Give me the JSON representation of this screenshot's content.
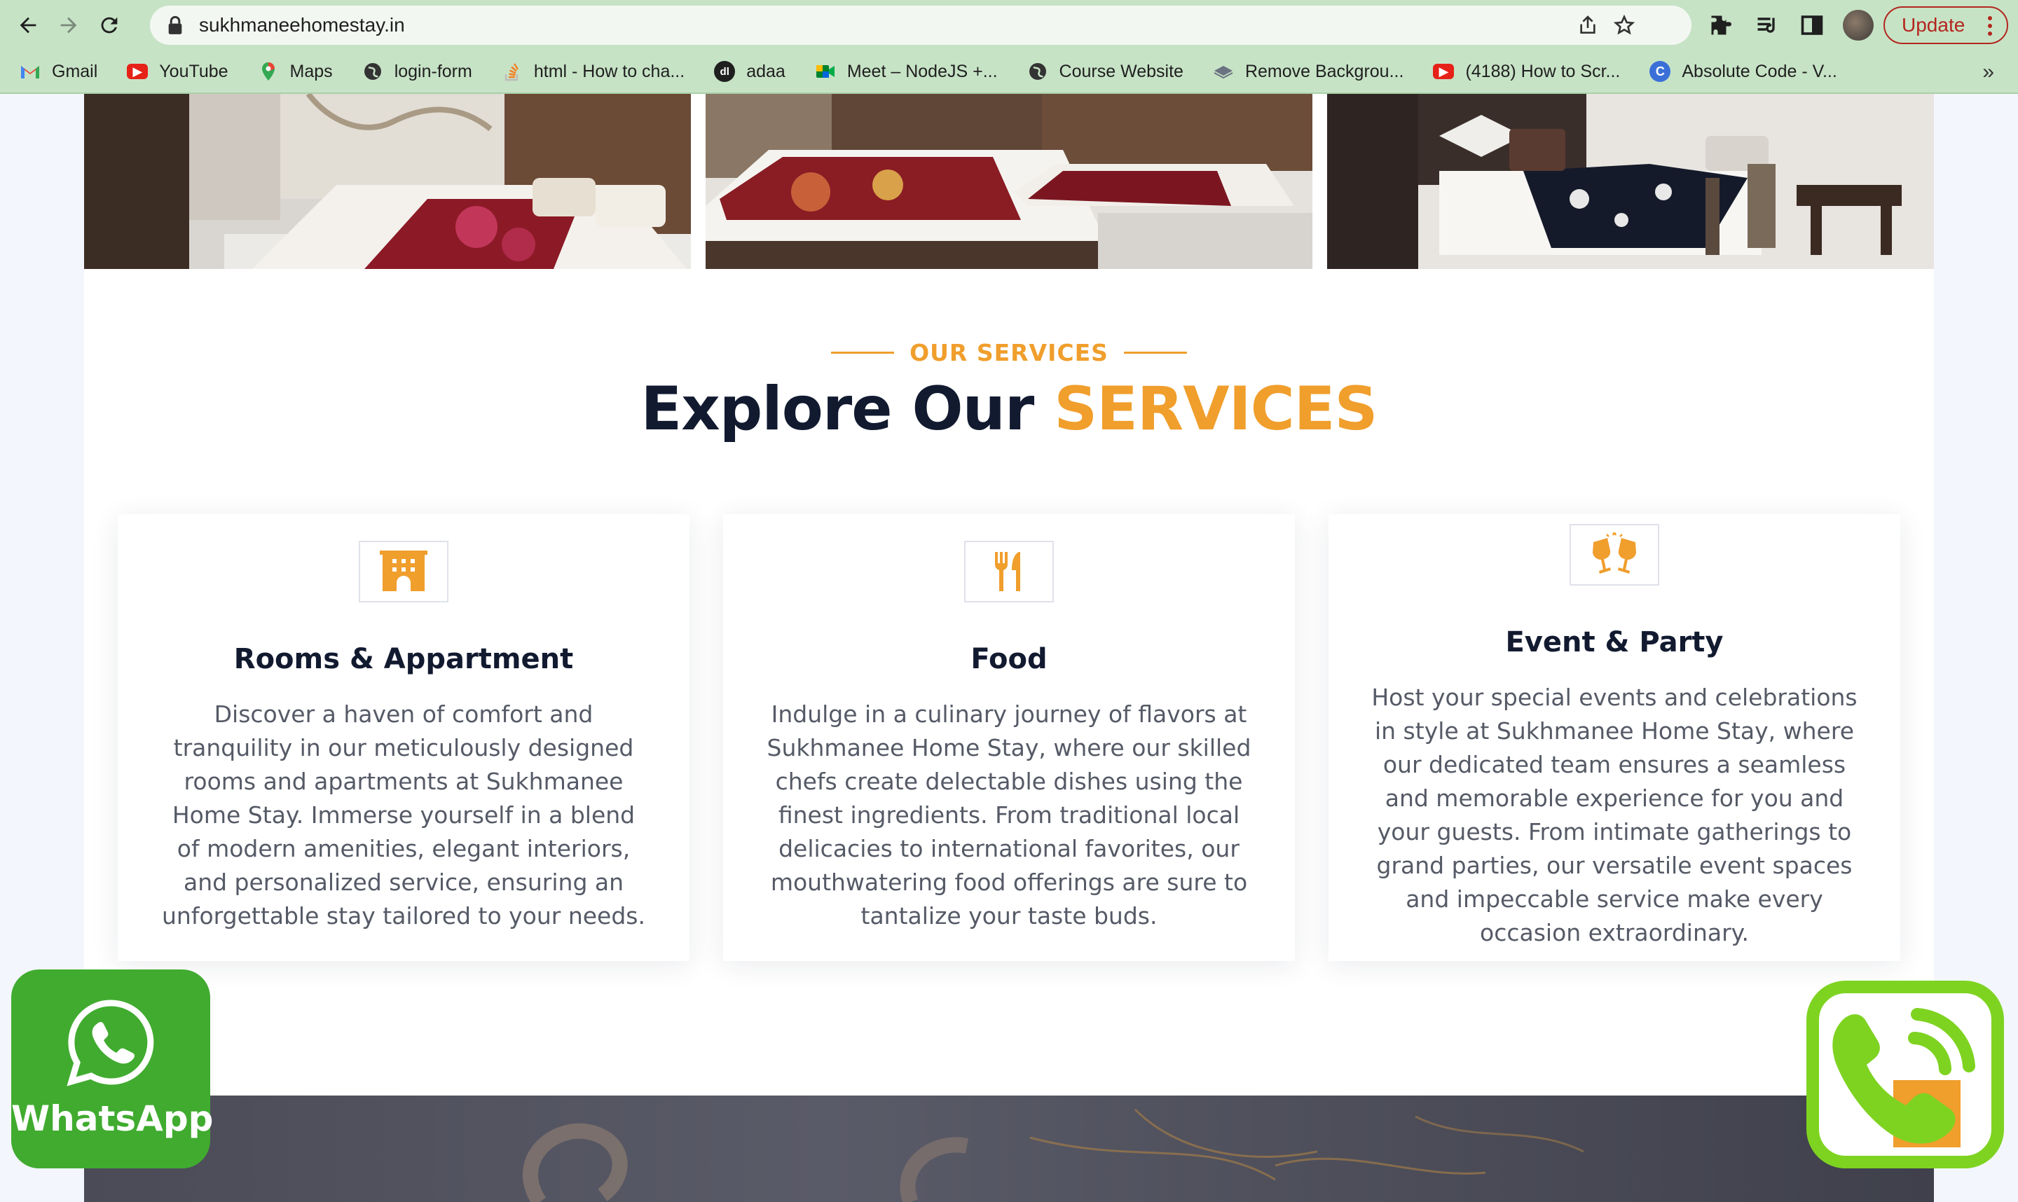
{
  "browser": {
    "url": "sukhmaneehomestay.in",
    "update_label": "Update",
    "bookmarks": [
      {
        "label": "Gmail",
        "icon": "gmail-icon"
      },
      {
        "label": "YouTube",
        "icon": "youtube-icon"
      },
      {
        "label": "Maps",
        "icon": "maps-icon"
      },
      {
        "label": "login-form",
        "icon": "globe-icon"
      },
      {
        "label": "html - How to cha...",
        "icon": "stackoverflow-icon"
      },
      {
        "label": "adaa",
        "icon": "adaa-icon"
      },
      {
        "label": "Meet – NodeJS +...",
        "icon": "meet-icon"
      },
      {
        "label": "Course Website",
        "icon": "globe-icon"
      },
      {
        "label": "Remove Backgrou...",
        "icon": "layers-icon"
      },
      {
        "label": "(4188) How to Scr...",
        "icon": "youtube-icon"
      },
      {
        "label": "Absolute Code - V...",
        "icon": "absolute-icon"
      }
    ],
    "more_label": "»"
  },
  "services": {
    "eyebrow": "OUR SERVICES",
    "heading_plain": "Explore Our ",
    "heading_accent": "SERVICES",
    "accent_color": "#f09e2c",
    "items": [
      {
        "title": "Rooms & Appartment",
        "icon": "hotel-building-icon",
        "text": "Discover a haven of comfort and tranquility in our meticulously designed rooms and apartments at Sukhmanee Home Stay. Immerse yourself in a blend of modern amenities, elegant interiors, and personalized service, ensuring an unforgettable stay tailored to your needs."
      },
      {
        "title": "Food",
        "icon": "fork-knife-icon",
        "text": "Indulge in a culinary journey of flavors at Sukhmanee Home Stay, where our skilled chefs create delectable dishes using the finest ingredients. From traditional local delicacies to international favorites, our mouthwatering food offerings are sure to tantalize your taste buds."
      },
      {
        "title": "Event & Party",
        "icon": "glasses-cheers-icon",
        "text": "Host your special events and celebrations in style at Sukhmanee Home Stay, where our dedicated team ensures a seamless and memorable experience for you and your guests. From intimate gatherings to grand parties, our versatile event spaces and impeccable service make every occasion extraordinary."
      }
    ]
  },
  "floating": {
    "whatsapp_label": "WhatsApp"
  }
}
